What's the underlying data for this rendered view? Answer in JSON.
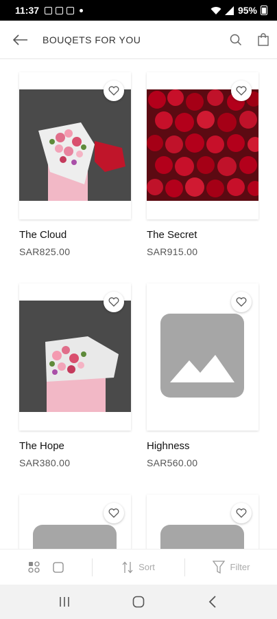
{
  "status": {
    "time": "11:37",
    "battery": "95%"
  },
  "header": {
    "title": "BOUQETS FOR YOU"
  },
  "products": [
    {
      "name": "The Cloud",
      "price": "SAR825.00",
      "image": "pink-bouquet-photo"
    },
    {
      "name": "The Secret",
      "price": "SAR915.00",
      "image": "red-roses-photo"
    },
    {
      "name": "The Hope",
      "price": "SAR380.00",
      "image": "pink-bouquet-photo"
    },
    {
      "name": "Highness",
      "price": "SAR560.00",
      "image": "placeholder-icon"
    },
    {
      "name": "",
      "price": "",
      "image": "placeholder-icon"
    },
    {
      "name": "",
      "price": "",
      "image": "placeholder-icon"
    }
  ],
  "toolbar": {
    "sort_label": "Sort",
    "filter_label": "Filter"
  },
  "colors": {
    "placeholder": "#a6a6a6",
    "rose": "#b3001b",
    "wrap_pink": "#f2b8c6"
  }
}
